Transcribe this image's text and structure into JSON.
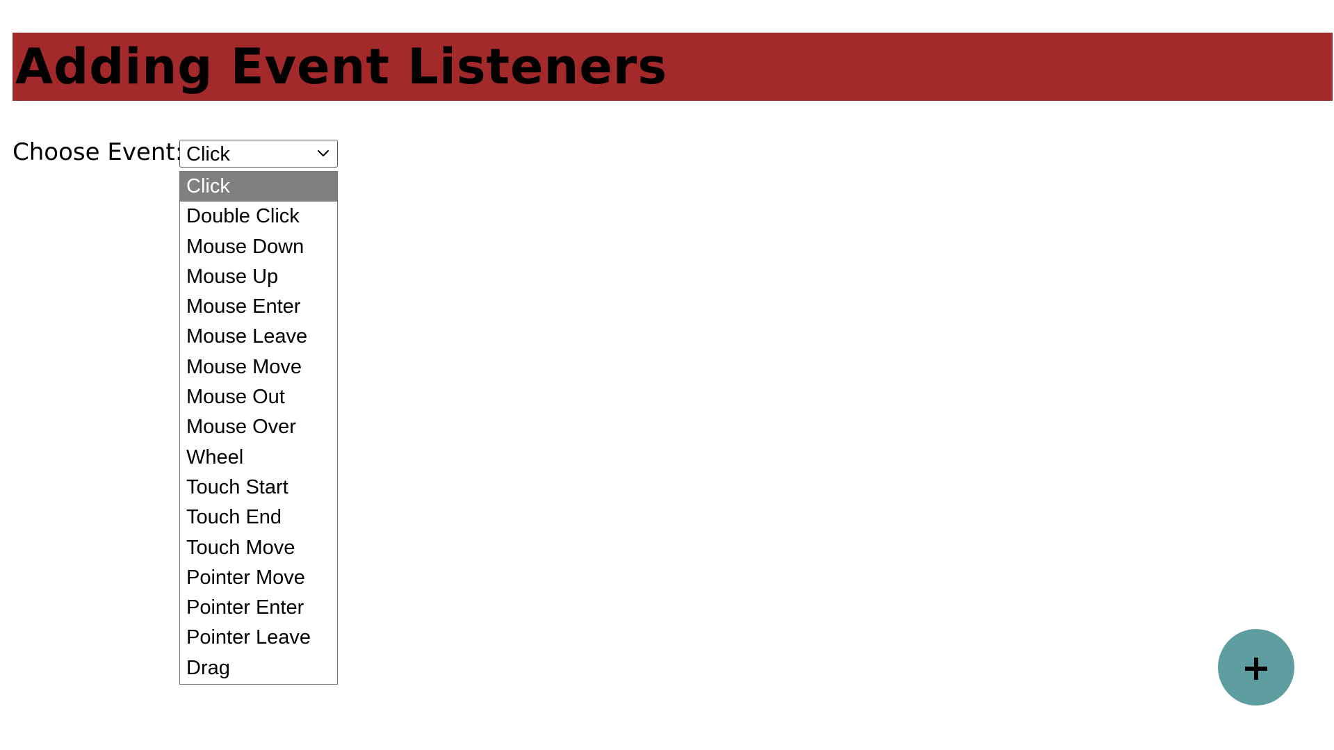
{
  "header": {
    "title": "Adding Event Listeners",
    "background_color": "#a4292b"
  },
  "event_picker": {
    "label": "Choose Event:",
    "selected_value": "Click",
    "options": [
      "Click",
      "Double Click",
      "Mouse Down",
      "Mouse Up",
      "Mouse Enter",
      "Mouse Leave",
      "Mouse Move",
      "Mouse Out",
      "Mouse Over",
      "Wheel",
      "Touch Start",
      "Touch End",
      "Touch Move",
      "Pointer Move",
      "Pointer Enter",
      "Pointer Leave",
      "Drag"
    ],
    "highlighted_option": "Click",
    "highlight_color": "#808080"
  },
  "fab": {
    "icon": "plus-icon",
    "color": "#5f9ea0"
  }
}
